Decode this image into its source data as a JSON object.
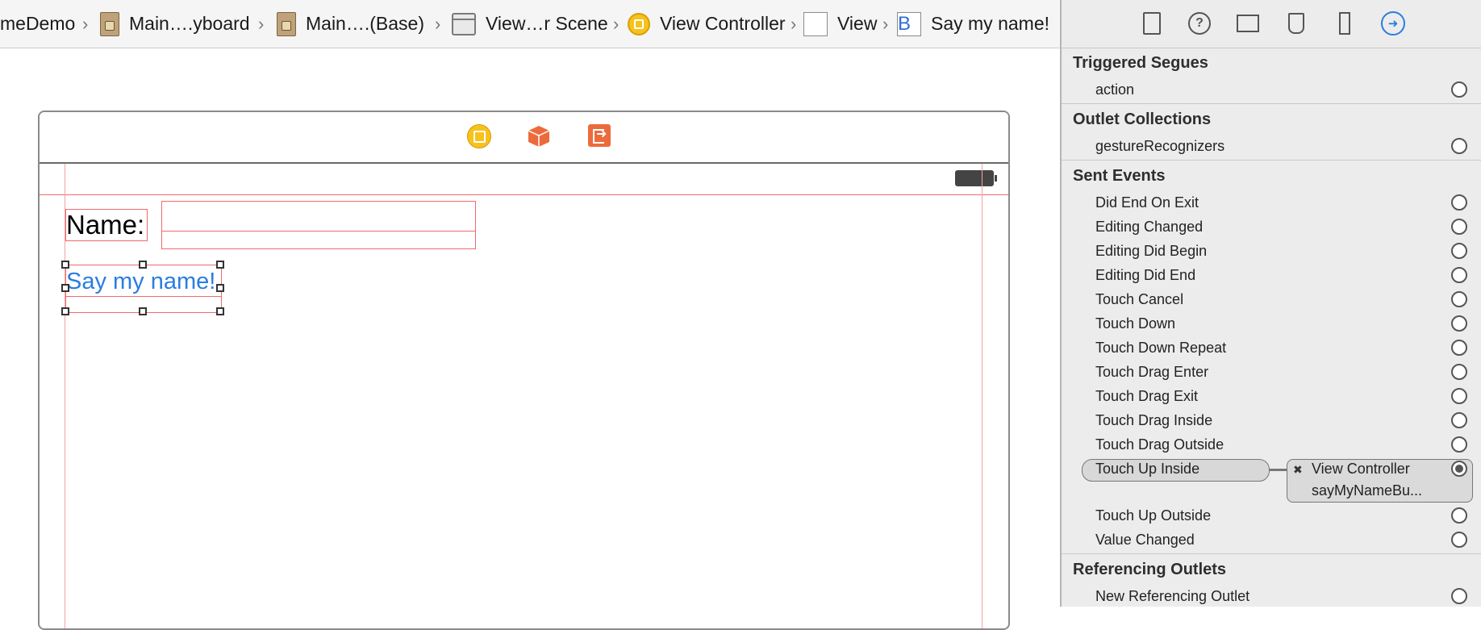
{
  "breadcrumb": {
    "project": "meDemo",
    "storyboard": "Main….yboard",
    "base": "Main….(Base)",
    "scene": "View…r Scene",
    "controller": "View Controller",
    "view": "View",
    "button": "Say my name!",
    "button_icon_letter": "B",
    "separator": "›"
  },
  "canvas": {
    "name_label": "Name:",
    "say_button_label": "Say my name!",
    "battery_icon": "battery-icon",
    "dock_icons": [
      "view-controller-icon",
      "first-responder-icon",
      "exit-icon"
    ],
    "guide_color": "#f06b6b",
    "button_text_color": "#2a7de1"
  },
  "inspector": {
    "tabs": [
      "file-inspector-icon",
      "quick-help-icon",
      "identity-inspector-icon",
      "attributes-inspector-icon",
      "size-inspector-icon",
      "connections-inspector-icon"
    ],
    "sections": {
      "triggered_segues": {
        "title": "Triggered Segues",
        "items": [
          "action"
        ]
      },
      "outlet_collections": {
        "title": "Outlet Collections",
        "items": [
          "gestureRecognizers"
        ]
      },
      "sent_events": {
        "title": "Sent Events",
        "items": [
          "Did End On Exit",
          "Editing Changed",
          "Editing Did Begin",
          "Editing Did End",
          "Touch Cancel",
          "Touch Down",
          "Touch Down Repeat",
          "Touch Drag Enter",
          "Touch Drag Exit",
          "Touch Drag Inside",
          "Touch Drag Outside",
          "Touch Up Inside",
          "Touch Up Outside",
          "Value Changed"
        ]
      },
      "referencing_outlets": {
        "title": "Referencing Outlets",
        "items": [
          "New Referencing Outlet"
        ]
      }
    },
    "connection": {
      "event": "Touch Up Inside",
      "target": "View Controller",
      "action": "sayMyNameBu...",
      "remove_glyph": "✖"
    },
    "accent_color": "#2a7de1"
  }
}
